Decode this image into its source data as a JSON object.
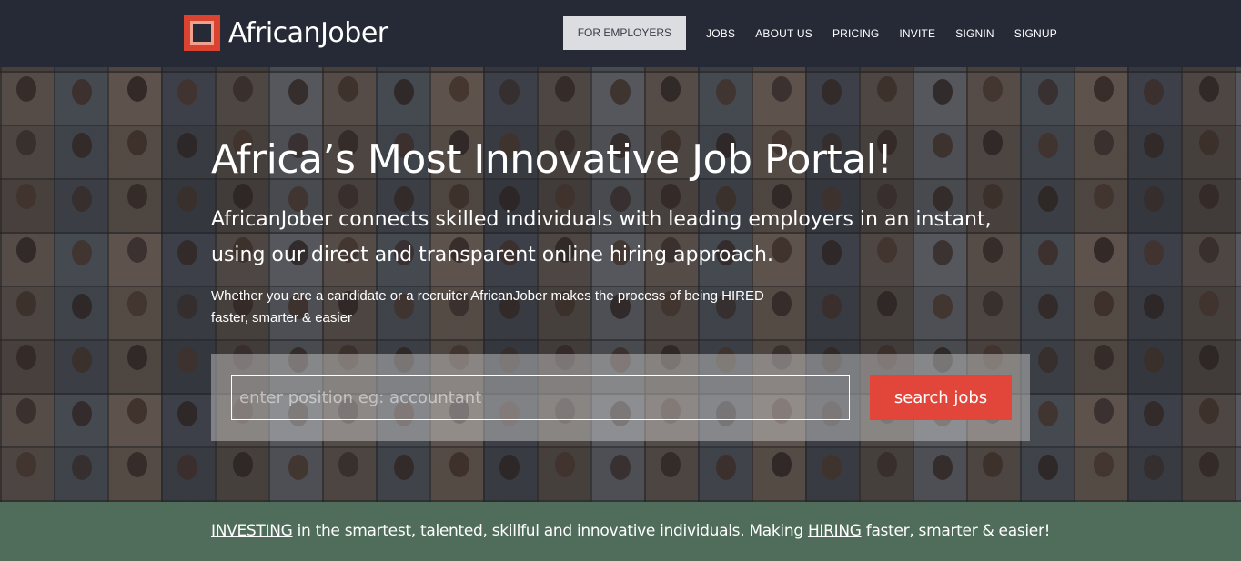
{
  "header": {
    "logo_text": "AfricanJober",
    "logo_icon": "square-logo-icon",
    "nav": {
      "for_employers": "FOR EMPLOYERS",
      "items": [
        "JOBS",
        "ABOUT US",
        "PRICING",
        "INVITE",
        "SIGNIN",
        "SIGNUP"
      ]
    }
  },
  "hero": {
    "title": "Africa’s Most Innovative Job Portal!",
    "lead": "AfricanJober connects skilled individuals with leading employers in an instant, using our direct and transparent online hiring approach.",
    "sub": "Whether you are a candidate or a recruiter AfricanJober makes the process of being HIRED faster, smarter & easier",
    "search": {
      "placeholder": "enter position eg: accountant",
      "value": "",
      "button_label": "search jobs"
    }
  },
  "banner": {
    "word1": "INVESTING",
    "text1": " in the smartest, talented, skillful and innovative individuals. Making ",
    "word2": "HIRING",
    "text2": " faster, smarter & easier!"
  },
  "colors": {
    "header_bg": "#262a36",
    "accent": "#e2463a",
    "banner_bg": "#4f6d5a",
    "logo_red": "#d9432f"
  }
}
